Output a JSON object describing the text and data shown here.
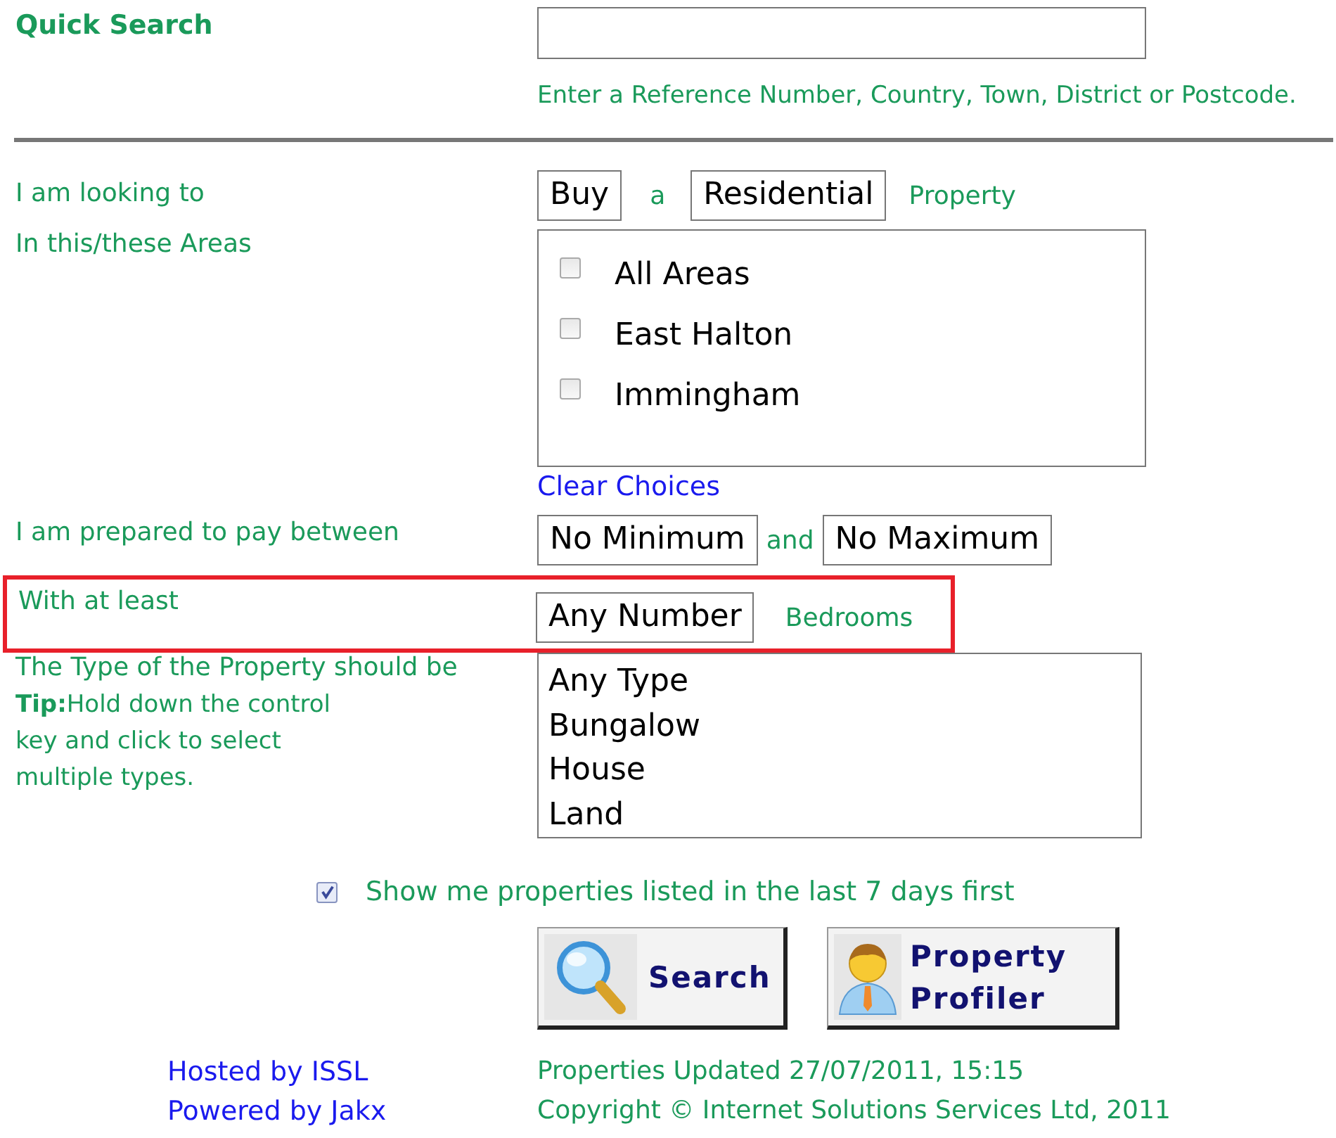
{
  "quick_search": {
    "label": "Quick Search",
    "hint": "Enter a Reference Number, Country, Town, District or Postcode."
  },
  "looking_to": {
    "label": "I am looking to",
    "transaction": "Buy",
    "connector": "a",
    "property_type": "Residential",
    "suffix": "Property"
  },
  "areas": {
    "label": "In this/these Areas",
    "clear_link": "Clear Choices",
    "options": [
      {
        "label": "All Areas",
        "checked": false
      },
      {
        "label": "East Halton",
        "checked": false
      },
      {
        "label": "Immingham",
        "checked": false
      }
    ]
  },
  "price": {
    "label": "I am prepared to pay between",
    "minimum": "No Minimum",
    "connector": "and",
    "maximum": "No Maximum"
  },
  "bedrooms": {
    "label": "With at least",
    "value": "Any Number",
    "suffix": "Bedrooms",
    "highlighted": true
  },
  "property_types": {
    "label": "The Type of the Property should be",
    "tip": "**Tip:**Hold down the control key and click to select multiple types.",
    "options": [
      {
        "label": "Any Type",
        "selected": false
      },
      {
        "label": "Bungalow",
        "selected": false
      },
      {
        "label": "House",
        "selected": false
      },
      {
        "label": "Land",
        "selected": false
      }
    ]
  },
  "recent_first": {
    "label": "Show me properties listed in the last 7 days first",
    "checked": true
  },
  "buttons": [
    {
      "kind": "search",
      "label": "Search"
    },
    {
      "kind": "profiler",
      "label": "Property Profiler"
    }
  ],
  "footer": {
    "links": [
      "Hosted by ISSL",
      "Powered by Jakx"
    ],
    "updated": "Properties Updated 27/07/2011, 15:15",
    "copyright": "Copyright © Internet Solutions Services Ltd, 2011"
  }
}
